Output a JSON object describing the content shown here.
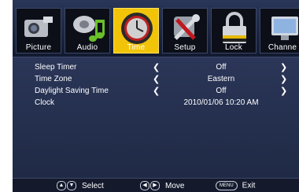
{
  "tabs": [
    {
      "label": "Picture",
      "icon": "camera-icon"
    },
    {
      "label": "Audio",
      "icon": "music-note-icon"
    },
    {
      "label": "Time",
      "icon": "clock-icon"
    },
    {
      "label": "Setup",
      "icon": "wrench-icon"
    },
    {
      "label": "Lock",
      "icon": "padlock-icon"
    },
    {
      "label": "Channe",
      "icon": "monitor-icon"
    }
  ],
  "active_tab": "Time",
  "settings": [
    {
      "label": "Sleep Timer",
      "value": "Off",
      "left_arrow": "❮",
      "right_arrow": "❯"
    },
    {
      "label": "Time Zone",
      "value": "Eastern",
      "left_arrow": "❮",
      "right_arrow": "❯"
    },
    {
      "label": "Daylight Saving Time",
      "value": "Off",
      "left_arrow": "❮",
      "right_arrow": "❯"
    },
    {
      "label": "Clock",
      "value": "2010/01/06 10:20 AM"
    }
  ],
  "hints": {
    "select": {
      "keys": [
        "▲",
        "▼"
      ],
      "label": "Select"
    },
    "move": {
      "keys": [
        "◀",
        "▶"
      ],
      "label": "Move"
    },
    "exit": {
      "key": "MENU",
      "label": "Exit"
    }
  },
  "colors": {
    "accent": "#f1c40a",
    "panel": "#1f2940"
  }
}
